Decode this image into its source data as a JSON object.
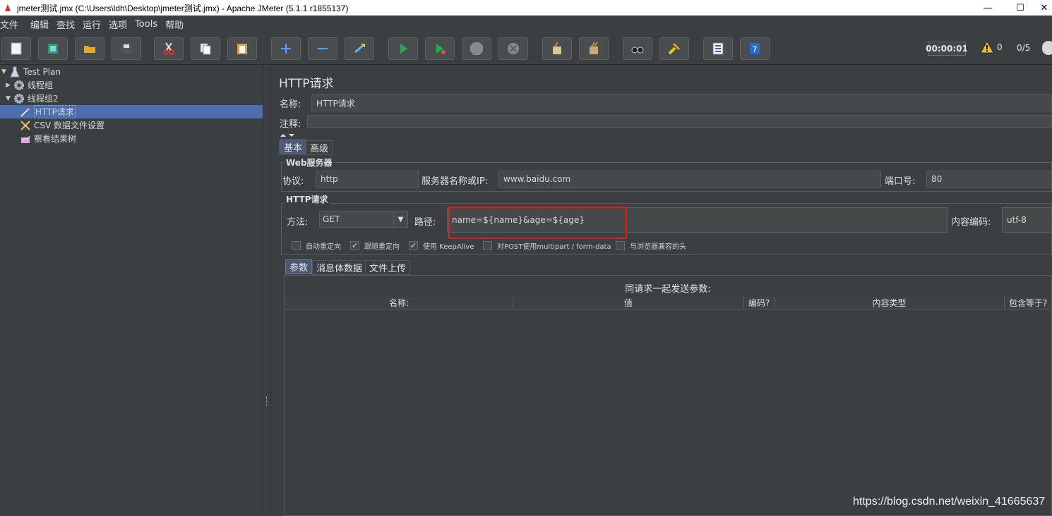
{
  "window": {
    "title": "jmeter测试.jmx (C:\\Users\\ldh\\Desktop\\jmeter测试.jmx) - Apache JMeter (5.1.1 r1855137)",
    "min": "—",
    "max": "☐",
    "close": "✕"
  },
  "menu": [
    "文件",
    "编辑",
    "查找",
    "运行",
    "选项",
    "Tools",
    "帮助"
  ],
  "toolbar": {
    "buttons": [
      "new-icon",
      "templates-icon",
      "open-icon",
      "save-icon",
      "cut-icon",
      "copy-icon",
      "paste-icon",
      "expand-icon",
      "collapse-icon",
      "toggle-icon",
      "start-icon",
      "start-no-pause-icon",
      "stop-icon",
      "shutdown-icon",
      "clear-icon",
      "clear-all-icon",
      "search-icon",
      "reset-search-icon",
      "function-helper-icon",
      "help-icon"
    ],
    "timer": "00:00:01",
    "warnings": "0",
    "threads": "0/5"
  },
  "tree": [
    {
      "label": "Test Plan",
      "icon": "test-plan-icon",
      "arrow": "▼"
    },
    {
      "label": "线程组",
      "icon": "gear-icon",
      "arrow": "▶"
    },
    {
      "label": "线程组2",
      "icon": "gear-icon",
      "arrow": "▼"
    },
    {
      "label": "HTTP请求",
      "icon": "sampler-icon",
      "arrow": ""
    },
    {
      "label": "CSV 数据文件设置",
      "icon": "config-icon",
      "arrow": ""
    },
    {
      "label": "察看结果树",
      "icon": "listener-icon",
      "arrow": ""
    }
  ],
  "panel": {
    "title": "HTTP请求",
    "name_label": "名称:",
    "name_value": "HTTP请求",
    "comment_label": "注释:",
    "comment_value": "",
    "tabs": [
      "基本",
      "高级"
    ],
    "web_server_group": "Web服务器",
    "protocol_label": "协议:",
    "protocol_value": "http",
    "server_label": "服务器名称或IP:",
    "server_value": "www.baidu.com",
    "port_label": "端口号:",
    "port_value": "80",
    "http_group": "HTTP请求",
    "method_label": "方法:",
    "method_value": "GET",
    "path_label": "路径:",
    "path_value": "name=${name}&age=${age}",
    "encoding_label": "内容编码:",
    "encoding_value": "utf-8",
    "checkboxes": [
      {
        "label": "自动重定向",
        "checked": false
      },
      {
        "label": "跟随重定向",
        "checked": true
      },
      {
        "label": "使用 KeepAlive",
        "checked": true
      },
      {
        "label": "对POST使用multipart / form-data",
        "checked": false
      },
      {
        "label": "与浏览器兼容的头",
        "checked": false
      }
    ],
    "sub_tabs": [
      "参数",
      "消息体数据",
      "文件上传"
    ],
    "params_title": "同请求一起发送参数:",
    "columns": [
      "名称:",
      "值",
      "编码?",
      "内容类型",
      "包含等于?"
    ]
  },
  "watermark": "https://blog.csdn.net/weixin_41665637",
  "colors": {
    "selection": "#4b6eaf",
    "highlight": "#e02020",
    "background": "#3c3f41"
  }
}
